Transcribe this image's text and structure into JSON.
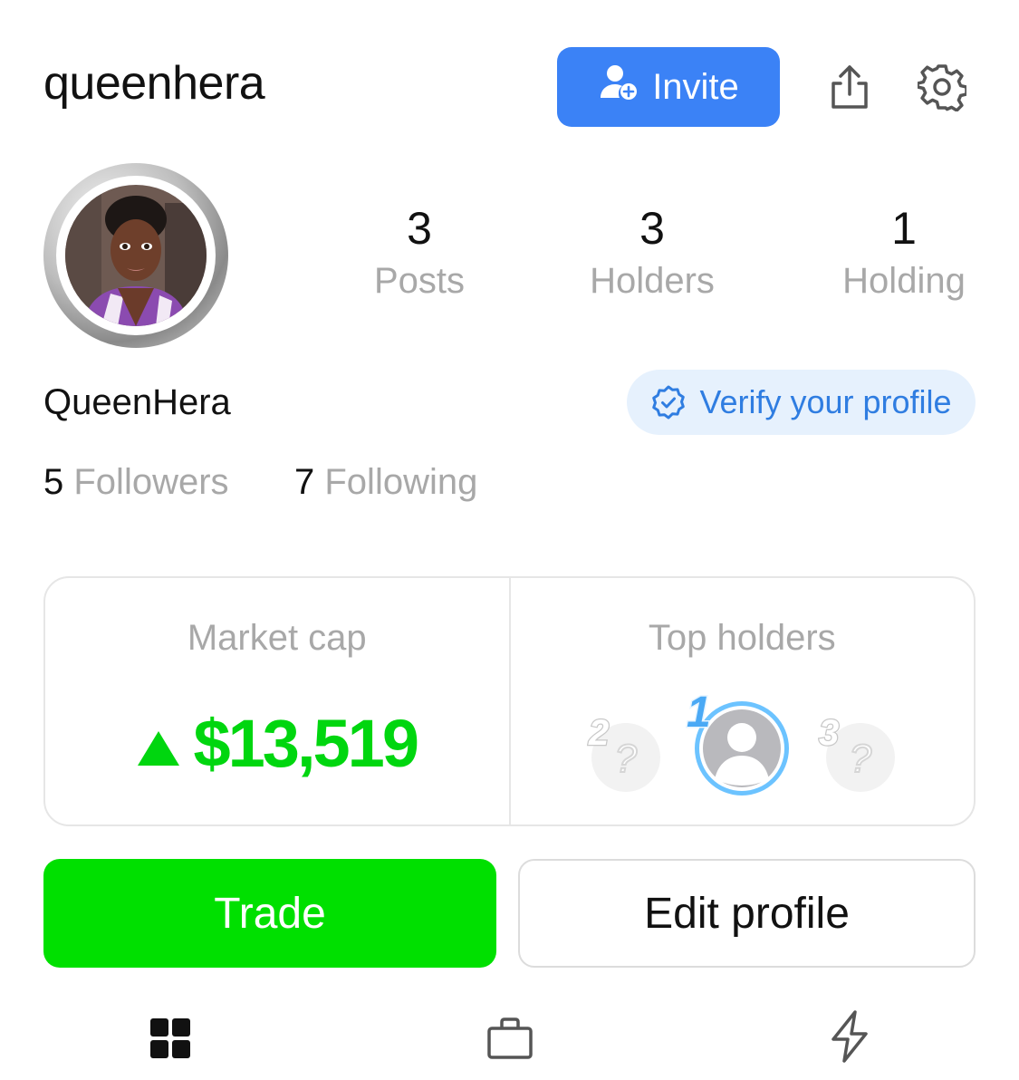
{
  "header": {
    "username": "queenhera",
    "invite_label": "Invite"
  },
  "profile": {
    "display_name": "QueenHera",
    "verify_label": "Verify your profile",
    "stats": [
      {
        "value": "3",
        "label": "Posts"
      },
      {
        "value": "3",
        "label": "Holders"
      },
      {
        "value": "1",
        "label": "Holding"
      }
    ],
    "followers_count": "5",
    "followers_label": "Followers",
    "following_count": "7",
    "following_label": "Following"
  },
  "market": {
    "market_cap_label": "Market cap",
    "market_cap_value": "$13,519",
    "top_holders_label": "Top holders",
    "holder_ranks": [
      "2",
      "1",
      "3"
    ]
  },
  "actions": {
    "trade_label": "Trade",
    "edit_label": "Edit profile"
  },
  "colors": {
    "accent_blue": "#3b82f6",
    "trade_green": "#00e000",
    "gain_green": "#00d60f",
    "muted_text": "#a8a8a8"
  },
  "icons": {
    "invite": "add-user-icon",
    "share": "share-icon",
    "settings": "gear-icon",
    "verify": "verified-badge-icon",
    "trend": "triangle-up-icon",
    "tabs": [
      "grid-icon",
      "shopping-bag-icon",
      "lightning-icon"
    ]
  }
}
